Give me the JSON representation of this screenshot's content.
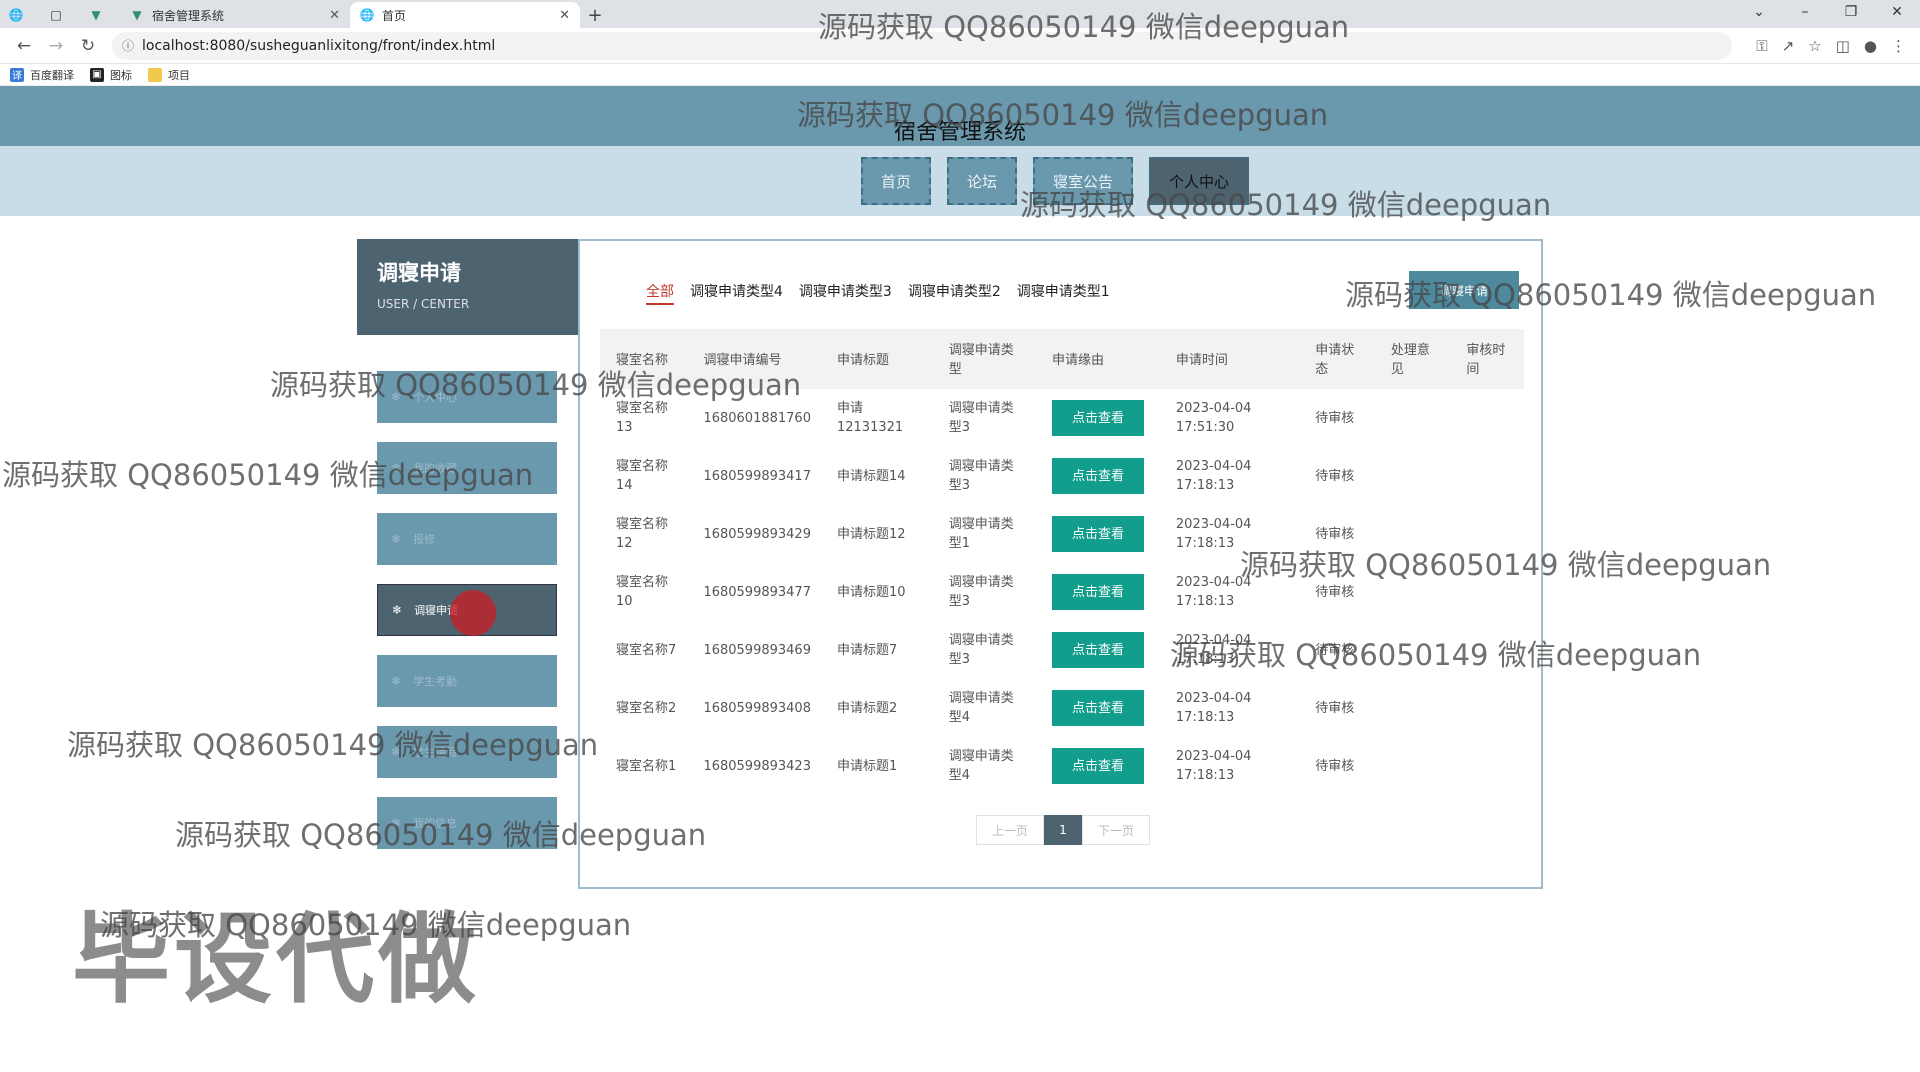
{
  "browser": {
    "tabs": [
      {
        "label": "宿舍管理系统"
      },
      {
        "label": "首页"
      }
    ],
    "url": "localhost:8080/susheguanlixitong/front/index.html",
    "bookmarks": [
      "百度翻译",
      "图标",
      "项目"
    ]
  },
  "site": {
    "title": "宿舍管理系统",
    "nav": [
      "首页",
      "论坛",
      "寝室公告",
      "个人中心"
    ]
  },
  "sidebar": {
    "heading": "调寝申请",
    "subheading": "USER / CENTER",
    "items": [
      "个人中心",
      "我的收藏",
      "报修",
      "调寝申请",
      "学生考勤",
      "学生请假",
      "我的信息"
    ]
  },
  "filters": [
    "全部",
    "调寝申请类型4",
    "调寝申请类型3",
    "调寝申请类型2",
    "调寝申请类型1"
  ],
  "apply_button": "调寝申请",
  "table": {
    "headers": [
      "寝室名称",
      "调寝申请编号",
      "申请标题",
      "调寝申请类型",
      "申请缘由",
      "申请时间",
      "申请状态",
      "处理意见",
      "审核时间"
    ],
    "rows": [
      {
        "room": "寝室名称13",
        "no": "1680601881760",
        "title": "申请12131321",
        "type": "调寝申请类型3",
        "btn": "点击查看",
        "time": "2023-04-04 17:51:30",
        "status": "待审核"
      },
      {
        "room": "寝室名称14",
        "no": "1680599893417",
        "title": "申请标题14",
        "type": "调寝申请类型3",
        "btn": "点击查看",
        "time": "2023-04-04 17:18:13",
        "status": "待审核"
      },
      {
        "room": "寝室名称12",
        "no": "1680599893429",
        "title": "申请标题12",
        "type": "调寝申请类型1",
        "btn": "点击查看",
        "time": "2023-04-04 17:18:13",
        "status": "待审核"
      },
      {
        "room": "寝室名称10",
        "no": "1680599893477",
        "title": "申请标题10",
        "type": "调寝申请类型3",
        "btn": "点击查看",
        "time": "2023-04-04 17:18:13",
        "status": "待审核"
      },
      {
        "room": "寝室名称7",
        "no": "1680599893469",
        "title": "申请标题7",
        "type": "调寝申请类型3",
        "btn": "点击查看",
        "time": "2023-04-04 17:18:13",
        "status": "待审核"
      },
      {
        "room": "寝室名称2",
        "no": "1680599893408",
        "title": "申请标题2",
        "type": "调寝申请类型4",
        "btn": "点击查看",
        "time": "2023-04-04 17:18:13",
        "status": "待审核"
      },
      {
        "room": "寝室名称1",
        "no": "1680599893423",
        "title": "申请标题1",
        "type": "调寝申请类型4",
        "btn": "点击查看",
        "time": "2023-04-04 17:18:13",
        "status": "待审核"
      }
    ]
  },
  "pager": {
    "prev": "上一页",
    "current": "1",
    "next": "下一页"
  },
  "watermark": "源码获取 QQ86050149 微信deepguan",
  "big_watermark": "毕设代做"
}
